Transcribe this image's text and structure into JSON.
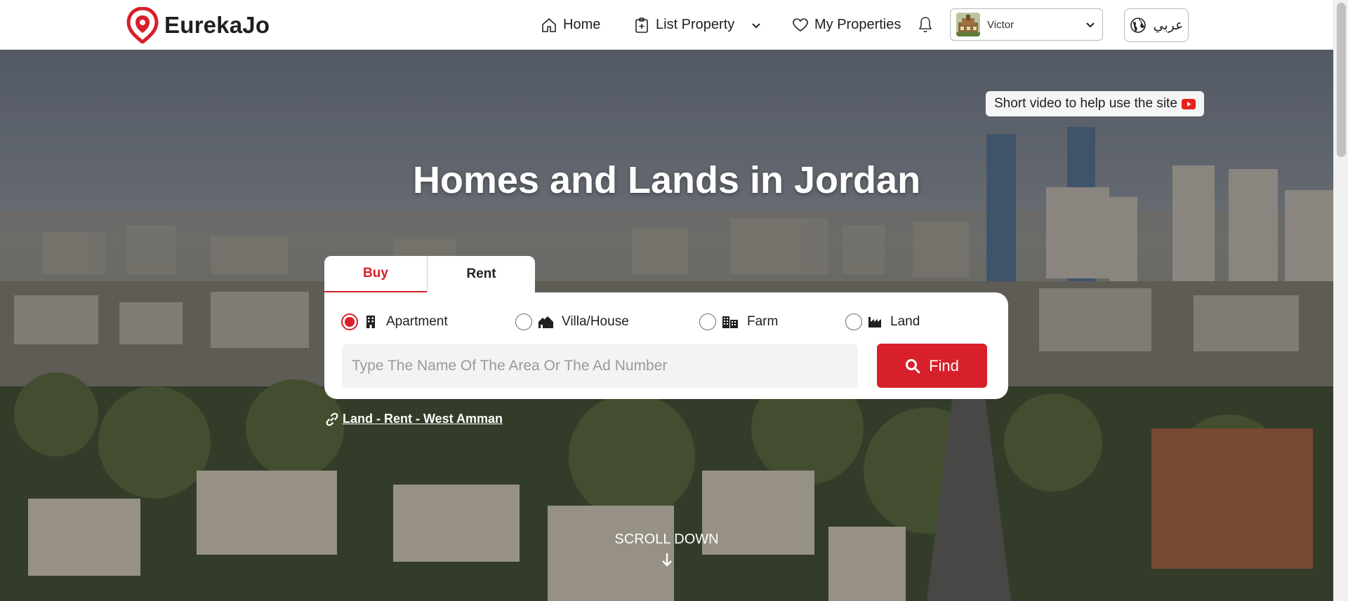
{
  "brand": {
    "name": "EurekaJo",
    "accent": "#d8202a"
  },
  "nav": {
    "home": "Home",
    "list_property": "List Property",
    "my_properties": "My Properties"
  },
  "user": {
    "name": "Victor"
  },
  "language": {
    "label": "عربي"
  },
  "hero": {
    "video_help": "Short video to help use the site",
    "title": "Homes and Lands in Jordan",
    "scroll_down": "SCROLL DOWN"
  },
  "search": {
    "tabs": [
      {
        "label": "Buy",
        "active": true
      },
      {
        "label": "Rent",
        "active": false
      }
    ],
    "property_types": [
      {
        "label": "Apartment",
        "icon": "building-icon",
        "selected": true
      },
      {
        "label": "Villa/House",
        "icon": "houses-icon",
        "selected": false
      },
      {
        "label": "Farm",
        "icon": "farm-buildings-icon",
        "selected": false
      },
      {
        "label": "Land",
        "icon": "industry-icon",
        "selected": false
      }
    ],
    "input": {
      "value": "",
      "placeholder": "Type The Name Of The Area Or The Ad Number"
    },
    "find_label": "Find"
  },
  "quick_link": {
    "label": "Land - Rent - West Amman"
  }
}
